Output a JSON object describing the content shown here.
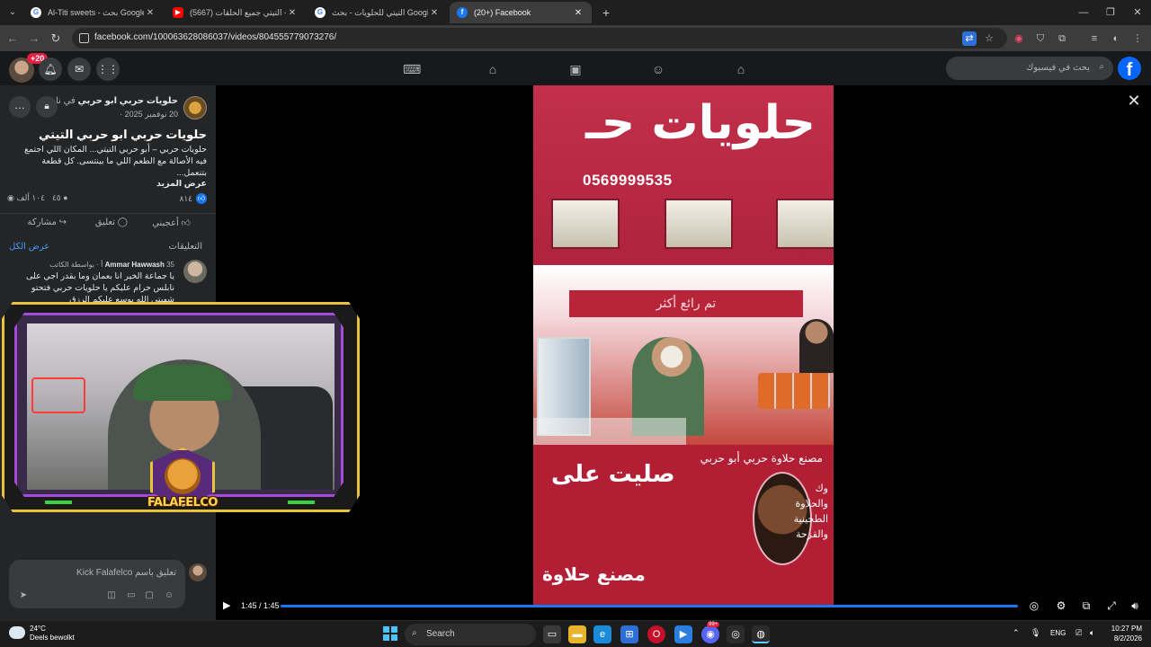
{
  "browser": {
    "tabs": [
      {
        "title": "Al-Titi sweets - بحث Google",
        "favicon": "G"
      },
      {
        "title": "(5667) التيتي جميع الحلقات - be",
        "favicon": "▶"
      },
      {
        "title": "التيتي للحلويات - بحث Google",
        "favicon": "G"
      },
      {
        "title": "(20+) Facebook",
        "favicon": "f"
      }
    ],
    "new_tab": "+",
    "url": "facebook.com/100063628086037/videos/804555779073276/",
    "window_controls": {
      "minimize": "—",
      "restore": "❐",
      "close": "✕"
    }
  },
  "facebook": {
    "notification_count": "+20",
    "search_placeholder": "بحث في فيسبوك",
    "logo": "f",
    "nav_icons": [
      "gaming-icon",
      "marketplace-icon",
      "video-icon",
      "groups-icon",
      "home-icon"
    ]
  },
  "post": {
    "page_name": "حلويات حربي ابو حربي",
    "in_text": "في ناب...",
    "date": "20 نوفمبر 2025 ·",
    "title": "حلويات حربي ابو حربي التيتي",
    "body": "حلويات حربي – أبو حربي التيتي... المكان اللي اجتمع فيه الأصالة مع الطعم اللي ما بينتسى. كل قطعة بتنعمل...",
    "see_more": "عرض المزيد",
    "reactions": "٨١٤",
    "comments_count": "٤٥",
    "views": "١٠٤ ألف",
    "actions": {
      "like": "أعجبني",
      "comment": "تعليق",
      "share": "مشاركة"
    }
  },
  "comments": {
    "heading": "التعليقات",
    "see_all": "عرض الكل",
    "items": [
      {
        "author": "Ammar Hawwash",
        "meta": "35 أ · ",
        "badge": "بواسطة الكاتب",
        "text": "يا جماعة الخير انا بعمان وما بقدر اجي على نابلس حرام عليكم يا حلويات حربي فتحتو شهيتي الله يوسع عليكم الرزق"
      }
    ],
    "input_placeholder": "تعليق باسم Kick Falafelco"
  },
  "stream_overlay": {
    "logo_text": "FALAFELCO"
  },
  "video": {
    "sign_text": "حلويات حـ",
    "phone": "0569999535",
    "banner": "تم رائع أكثر",
    "counter_top": "مصنع حلاوة حربي أبو حربي",
    "counter_main": "صليت على",
    "counter_side": [
      "وك",
      "والحلاوة",
      "الطحينية",
      "والقزحة"
    ],
    "counter_bottom": "مصنع حلاوة",
    "time": "1:45 / 1:45",
    "progress": 1.0
  },
  "taskbar": {
    "weather_temp": "24°C",
    "weather_desc": "Deels bewolkt",
    "search_label": "Search",
    "lang": "ENG",
    "time": "10:27 PM",
    "date": "8/2/2026",
    "discord_badge": "99+"
  }
}
